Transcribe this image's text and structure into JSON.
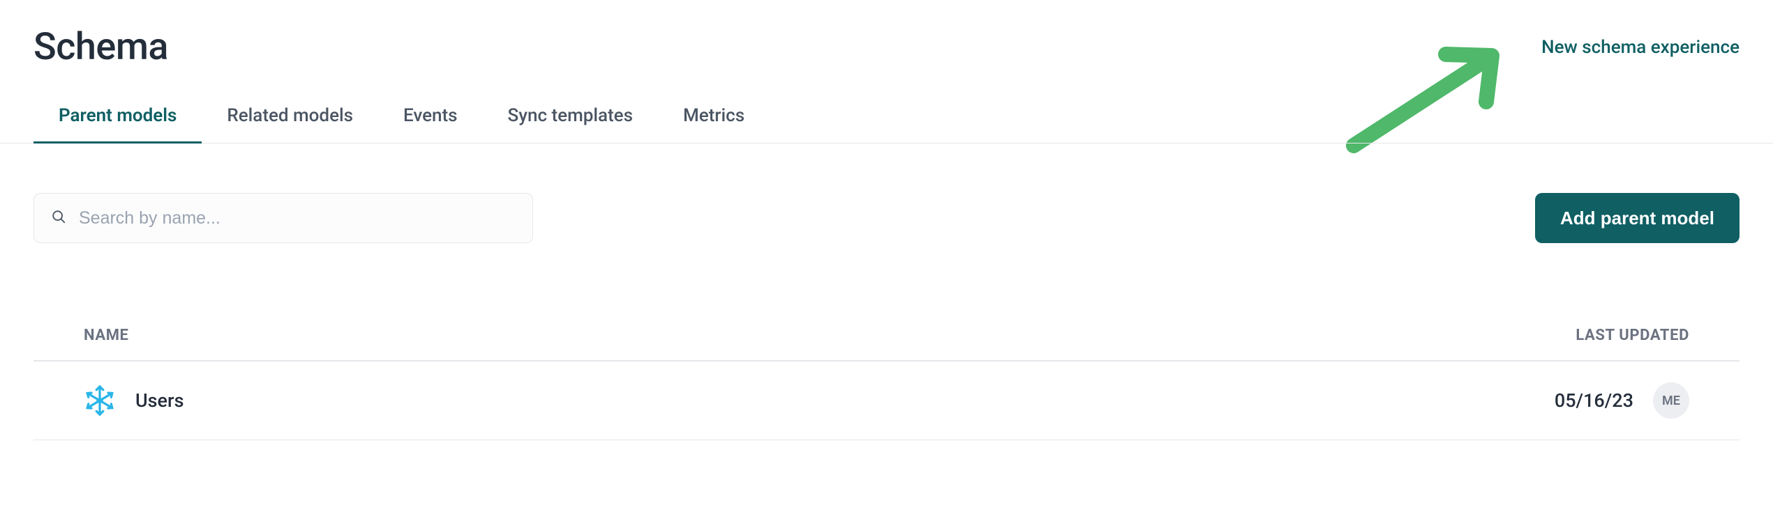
{
  "header": {
    "title": "Schema",
    "new_experience_link": "New schema experience"
  },
  "tabs": [
    {
      "label": "Parent models",
      "active": true
    },
    {
      "label": "Related models",
      "active": false
    },
    {
      "label": "Events",
      "active": false
    },
    {
      "label": "Sync templates",
      "active": false
    },
    {
      "label": "Metrics",
      "active": false
    }
  ],
  "toolbar": {
    "search_placeholder": "Search by name...",
    "add_button_label": "Add parent model"
  },
  "table": {
    "columns": {
      "name": "NAME",
      "last_updated": "LAST UPDATED"
    },
    "rows": [
      {
        "name": "Users",
        "connector_icon": "snowflake-icon",
        "last_updated": "05/16/23",
        "updated_by_initials": "ME"
      }
    ]
  }
}
